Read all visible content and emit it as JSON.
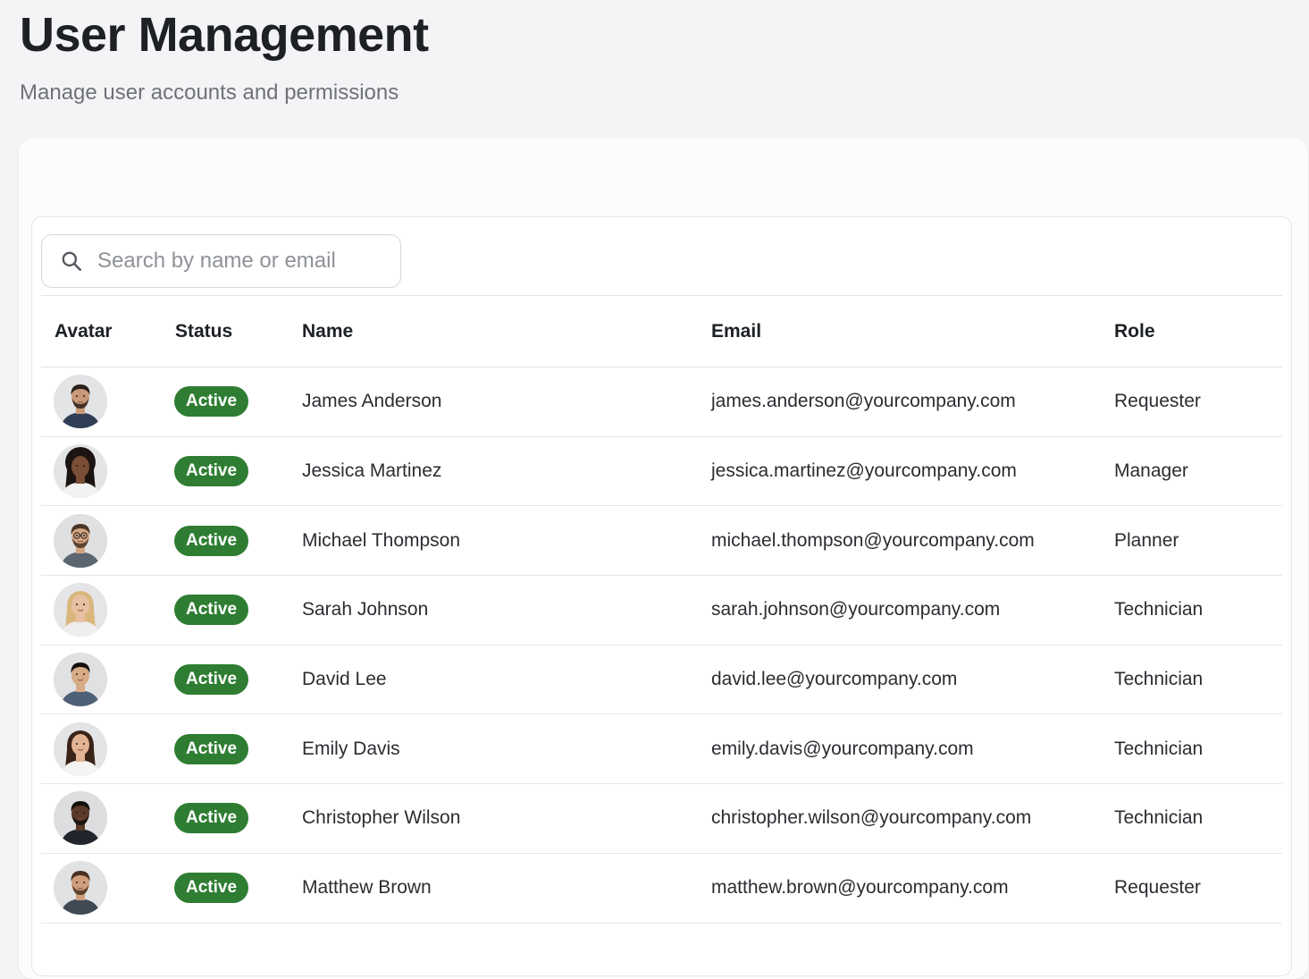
{
  "header": {
    "title": "User Management",
    "subtitle": "Manage user accounts and permissions"
  },
  "search": {
    "placeholder": "Search by name or email",
    "value": ""
  },
  "table": {
    "columns": [
      "Avatar",
      "Status",
      "Name",
      "Email",
      "Role"
    ],
    "rows": [
      {
        "status": "Active",
        "name": "James Anderson",
        "email": "james.anderson@yourcompany.com",
        "role": "Requester",
        "avatar": {
          "skin": "#c99a78",
          "hair": "#2b211b",
          "shirt": "#2f3e55",
          "bg": "#e3e4e6",
          "long": false,
          "beard": true
        }
      },
      {
        "status": "Active",
        "name": "Jessica Martinez",
        "email": "jessica.martinez@yourcompany.com",
        "role": "Manager",
        "avatar": {
          "skin": "#7a4e35",
          "hair": "#1b1410",
          "shirt": "#f2f2f2",
          "bg": "#e3e4e6",
          "long": true,
          "curly": true
        }
      },
      {
        "status": "Active",
        "name": "Michael Thompson",
        "email": "michael.thompson@yourcompany.com",
        "role": "Planner",
        "avatar": {
          "skin": "#d2a482",
          "hair": "#4a3426",
          "shirt": "#5b6670",
          "bg": "#dfe0e2",
          "long": false,
          "beard": true,
          "glasses": true
        }
      },
      {
        "status": "Active",
        "name": "Sarah Johnson",
        "email": "sarah.johnson@yourcompany.com",
        "role": "Technician",
        "avatar": {
          "skin": "#e8c0a2",
          "hair": "#d9b77c",
          "shirt": "#eeeeee",
          "bg": "#e5e5e7",
          "long": true
        }
      },
      {
        "status": "Active",
        "name": "David Lee",
        "email": "david.lee@yourcompany.com",
        "role": "Technician",
        "avatar": {
          "skin": "#d7ab85",
          "hair": "#15110e",
          "shirt": "#4d6075",
          "bg": "#e0e1e3",
          "long": false
        }
      },
      {
        "status": "Active",
        "name": "Emily Davis",
        "email": "emily.davis@yourcompany.com",
        "role": "Technician",
        "avatar": {
          "skin": "#e2b493",
          "hair": "#3a2417",
          "shirt": "#f4f4f4",
          "bg": "#e3e4e6",
          "long": true
        }
      },
      {
        "status": "Active",
        "name": "Christopher Wilson",
        "email": "christopher.wilson@yourcompany.com",
        "role": "Technician",
        "avatar": {
          "skin": "#5a3a28",
          "hair": "#14100d",
          "shirt": "#22262c",
          "bg": "#dddee0",
          "long": false,
          "beard": true
        }
      },
      {
        "status": "Active",
        "name": "Matthew Brown",
        "email": "matthew.brown@yourcompany.com",
        "role": "Requester",
        "avatar": {
          "skin": "#cf9f7d",
          "hair": "#4b3020",
          "shirt": "#3f4a55",
          "bg": "#e1e2e4",
          "long": false,
          "beard": true
        }
      }
    ]
  },
  "colors": {
    "active_badge": "#2e7d32",
    "page_bg": "#f4f4f6"
  }
}
